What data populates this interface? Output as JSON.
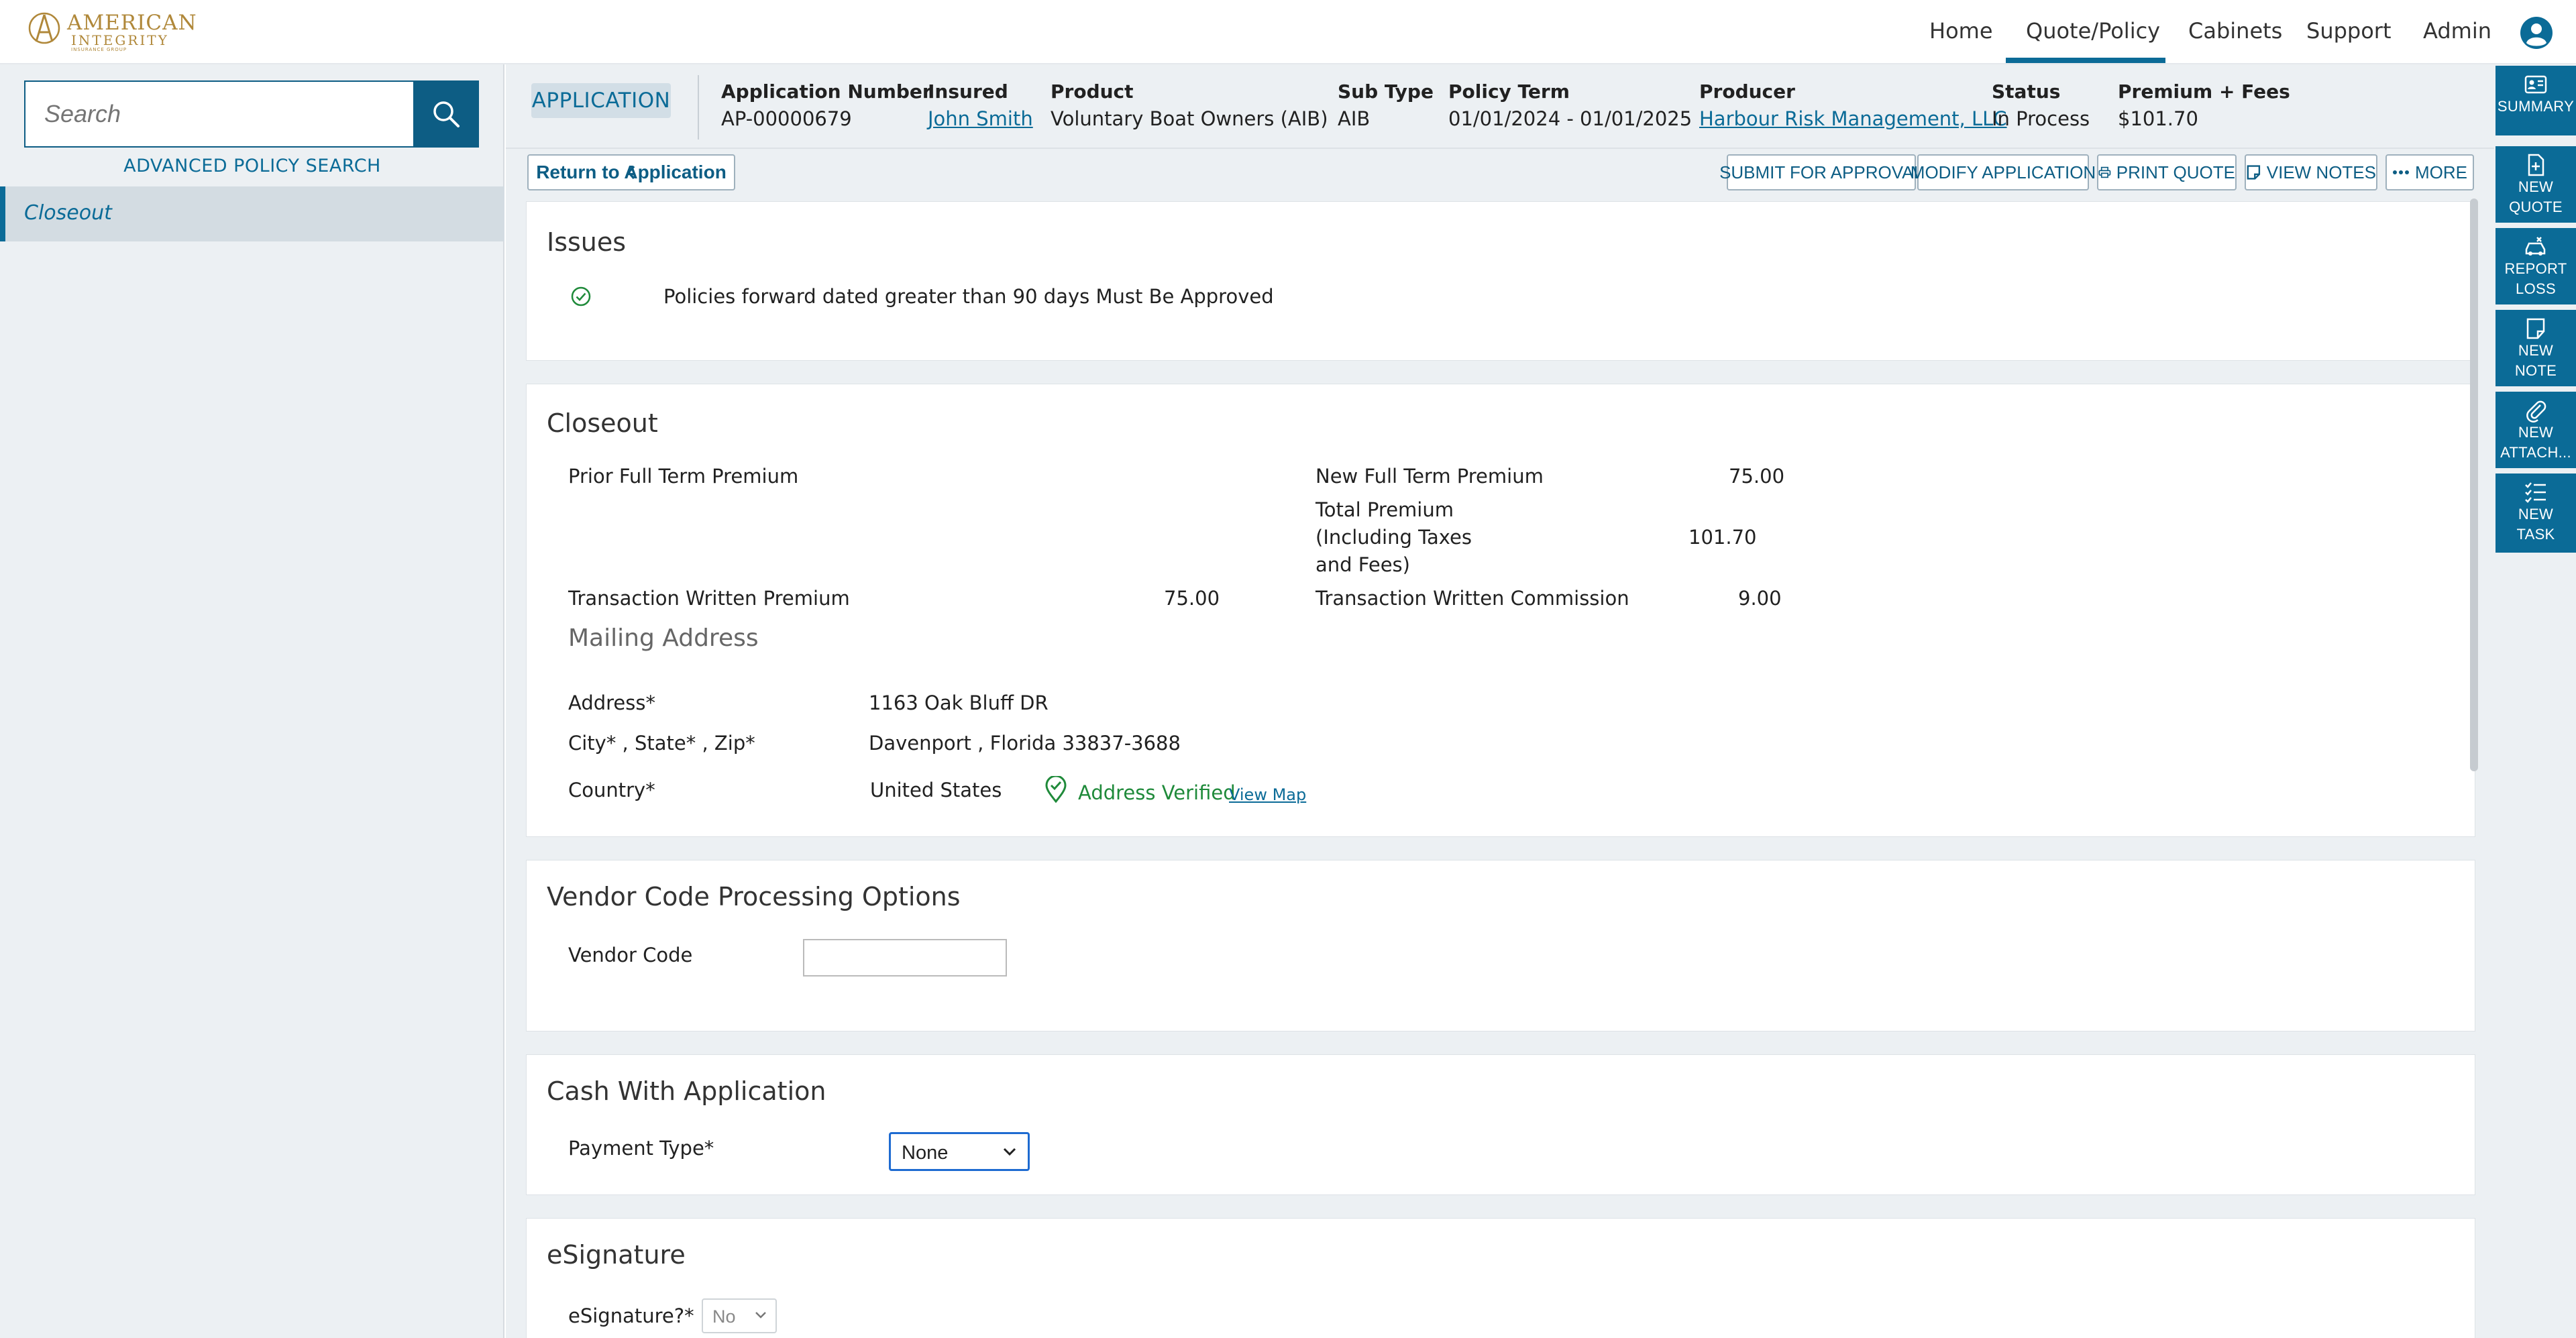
{
  "brand": {
    "line1": "AMERICAN",
    "line2": "INTEGRITY",
    "tagline": "INSURANCE GROUP"
  },
  "nav": {
    "items": [
      "Home",
      "Quote/Policy",
      "Cabinets",
      "Support",
      "Admin"
    ],
    "active": "Quote/Policy"
  },
  "search": {
    "placeholder": "Search",
    "advanced_label": "ADVANCED POLICY SEARCH"
  },
  "sidebar": {
    "items": [
      {
        "label": "Closeout",
        "active": true
      }
    ]
  },
  "header": {
    "badge": "APPLICATION",
    "fields": [
      {
        "label": "Application Number",
        "value": "AP-00000679"
      },
      {
        "label": "Insured",
        "value": "John Smith"
      },
      {
        "label": "Product",
        "value": "Voluntary Boat Owners (AIB)"
      },
      {
        "label": "Sub Type",
        "value": "AIB"
      },
      {
        "label": "Policy Term",
        "value": "01/01/2024 - 01/01/2025"
      },
      {
        "label": "Producer",
        "value": "Harbour Risk Management, LLC"
      },
      {
        "label": "Status",
        "value": "In Process"
      },
      {
        "label": "Premium + Fees",
        "value": "$101.70"
      }
    ]
  },
  "actions": {
    "return": "Return to Application",
    "submit": "SUBMIT FOR APPROVAL",
    "modify": "MODIFY APPLICATION",
    "print": "PRINT QUOTE",
    "notes": "VIEW NOTES",
    "more": "MORE"
  },
  "issues": {
    "title": "Issues",
    "items": [
      "Policies forward dated greater than 90 days Must Be Approved"
    ]
  },
  "closeout": {
    "title": "Closeout",
    "prior_full_term_label": "Prior Full Term Premium",
    "new_full_term_label": "New Full Term Premium",
    "new_full_term_value": "75.00",
    "total_premium_label_1": "Total Premium",
    "total_premium_label_2": "(Including Taxes",
    "total_premium_label_3": "and Fees)",
    "total_premium_value": "101.70",
    "transaction_written_premium_label": "Transaction Written Premium",
    "transaction_written_premium_value": "75.00",
    "transaction_written_commission_label": "Transaction Written Commission",
    "transaction_written_commission_value": "9.00",
    "mailing_title": "Mailing Address",
    "address_label": "Address*",
    "address_value": "1163 Oak Bluff DR",
    "city_label": "City*  , State*  , Zip*",
    "city_value": "Davenport , Florida 33837-3688",
    "country_label": "Country*",
    "country_value": "United States",
    "verified_text": "Address Verified",
    "view_map": "View Map"
  },
  "vendor": {
    "title": "Vendor Code Processing Options",
    "label": "Vendor Code",
    "value": ""
  },
  "cash": {
    "title": "Cash With Application",
    "label": "Payment Type*",
    "selected": "None"
  },
  "esignature": {
    "title": "eSignature",
    "label": "eSignature?*",
    "selected": "No"
  },
  "rail": {
    "items": [
      {
        "line1": "SUMMARY",
        "line2": ""
      },
      {
        "line1": "NEW",
        "line2": "QUOTE"
      },
      {
        "line1": "REPORT",
        "line2": "LOSS"
      },
      {
        "line1": "NEW",
        "line2": "NOTE"
      },
      {
        "line1": "NEW",
        "line2": "ATTACH..."
      },
      {
        "line1": "NEW",
        "line2": "TASK"
      }
    ]
  },
  "colors": {
    "primary": "#0b6b97",
    "dark_primary": "#0d5d84",
    "panel_bg": "#ecf0f3",
    "success": "#1f8a3a",
    "brand_gold": "#b0883a"
  }
}
